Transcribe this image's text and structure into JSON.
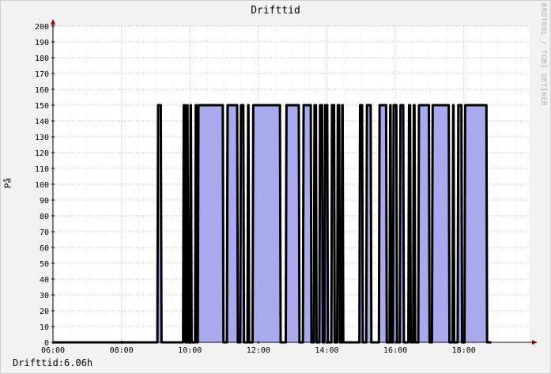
{
  "chart_data": {
    "type": "area",
    "title": "Drifttid",
    "ylabel": "På",
    "xlabel": "",
    "ylim": [
      0,
      200
    ],
    "yticks": [
      0,
      10,
      20,
      30,
      40,
      50,
      60,
      70,
      80,
      90,
      100,
      110,
      120,
      130,
      140,
      150,
      160,
      170,
      180,
      190,
      200
    ],
    "xlim_hours": [
      6.0,
      19.9
    ],
    "xticks": [
      {
        "hour": 6,
        "label": "06:00"
      },
      {
        "hour": 8,
        "label": "08:00"
      },
      {
        "hour": 10,
        "label": "10:00"
      },
      {
        "hour": 12,
        "label": "12:00"
      },
      {
        "hour": 14,
        "label": "14:00"
      },
      {
        "hour": 16,
        "label": "16:00"
      },
      {
        "hour": 18,
        "label": "18:00"
      }
    ],
    "grid": true,
    "fill_color": "#a9aaee",
    "line_color": "#000000",
    "on_value": 150,
    "on_intervals_hours": [
      [
        9.05,
        9.17
      ],
      [
        9.8,
        9.87
      ],
      [
        9.9,
        9.95
      ],
      [
        10.0,
        10.05
      ],
      [
        10.15,
        10.2
      ],
      [
        10.23,
        10.98
      ],
      [
        11.08,
        11.4
      ],
      [
        11.47,
        11.58
      ],
      [
        11.68,
        11.73
      ],
      [
        11.83,
        12.65
      ],
      [
        12.8,
        13.2
      ],
      [
        13.3,
        13.55
      ],
      [
        13.62,
        13.7
      ],
      [
        13.78,
        13.88
      ],
      [
        13.93,
        14.03
      ],
      [
        14.13,
        14.23
      ],
      [
        14.3,
        14.38
      ],
      [
        14.43,
        14.48
      ],
      [
        14.95,
        15.05
      ],
      [
        15.15,
        15.3
      ],
      [
        15.52,
        15.75
      ],
      [
        15.83,
        15.88
      ],
      [
        15.93,
        16.05
      ],
      [
        16.13,
        16.25
      ],
      [
        16.38,
        16.45
      ],
      [
        16.52,
        16.58
      ],
      [
        16.67,
        17.0
      ],
      [
        17.07,
        17.58
      ],
      [
        17.67,
        17.72
      ],
      [
        17.82,
        17.95
      ],
      [
        18.02,
        18.68
      ]
    ]
  },
  "legend": {
    "text": "Drifttid:6.06h"
  },
  "watermark": "RRDTOOL / TOBI OETIKER"
}
